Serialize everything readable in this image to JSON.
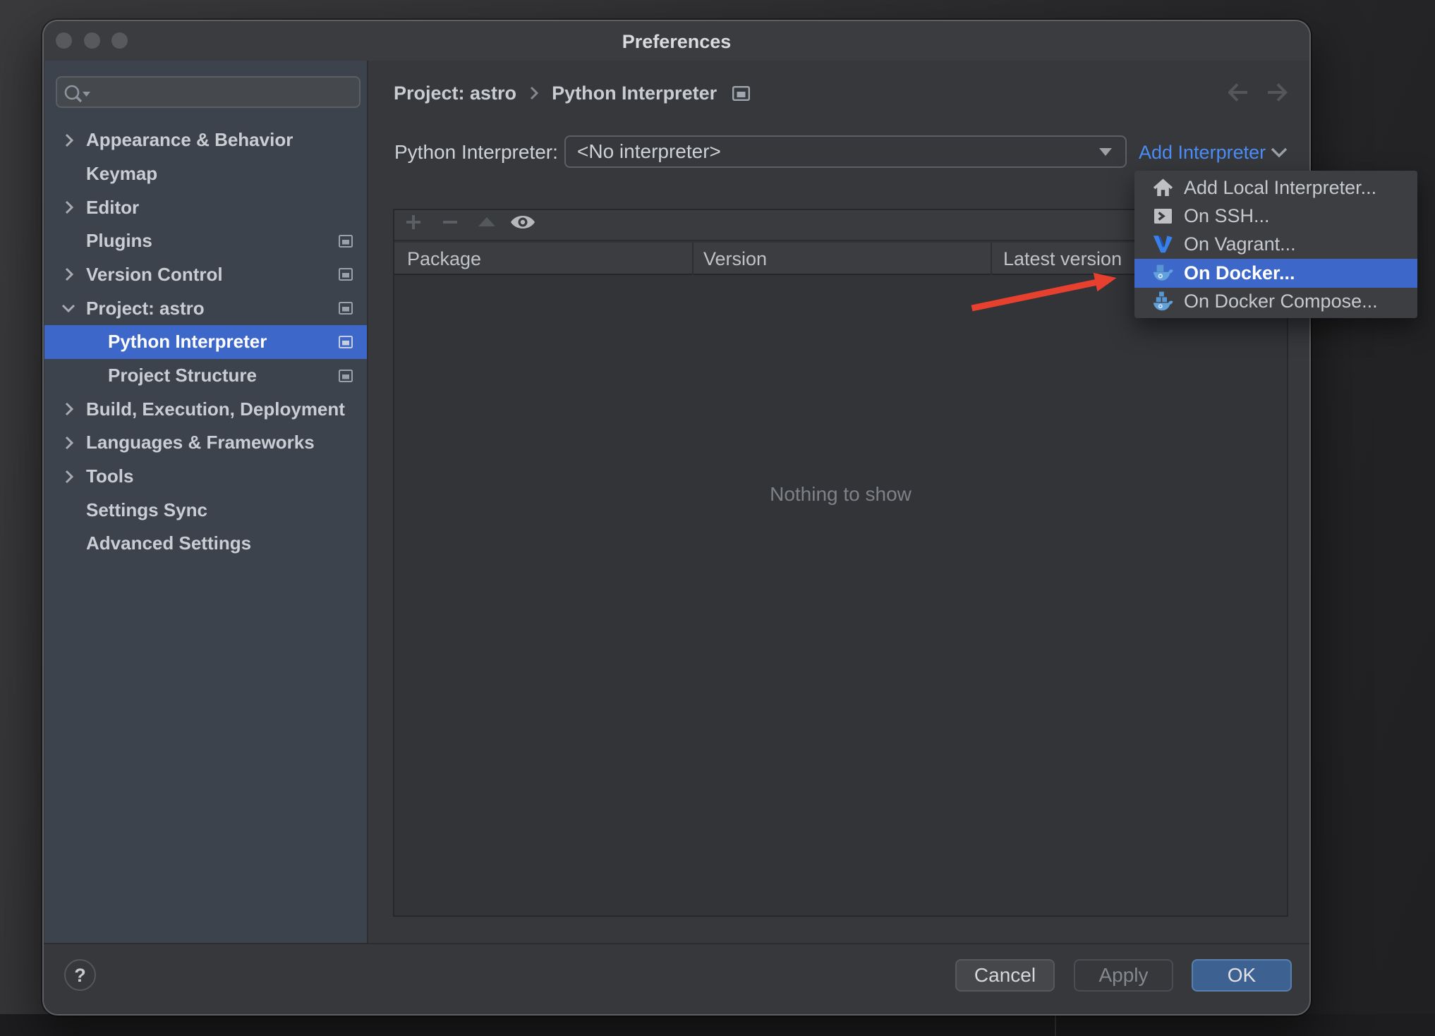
{
  "window": {
    "title": "Preferences"
  },
  "sidebar": {
    "search_placeholder": "",
    "items": [
      {
        "label": "Appearance & Behavior"
      },
      {
        "label": "Keymap"
      },
      {
        "label": "Editor"
      },
      {
        "label": "Plugins"
      },
      {
        "label": "Version Control"
      },
      {
        "label": "Project: astro"
      },
      {
        "label": "Python Interpreter"
      },
      {
        "label": "Project Structure"
      },
      {
        "label": "Build, Execution, Deployment"
      },
      {
        "label": "Languages & Frameworks"
      },
      {
        "label": "Tools"
      },
      {
        "label": "Settings Sync"
      },
      {
        "label": "Advanced Settings"
      }
    ]
  },
  "breadcrumb": {
    "first": "Project: astro",
    "second": "Python Interpreter"
  },
  "interpreter": {
    "label": "Python Interpreter:",
    "value": "<No interpreter>",
    "add_link": "Add Interpreter"
  },
  "menu": {
    "items": [
      {
        "label": "Add Local Interpreter..."
      },
      {
        "label": "On SSH..."
      },
      {
        "label": "On Vagrant..."
      },
      {
        "label": "On Docker..."
      },
      {
        "label": "On Docker Compose..."
      }
    ]
  },
  "table": {
    "columns": [
      "Package",
      "Version",
      "Latest version"
    ],
    "empty_text": "Nothing to show"
  },
  "footer": {
    "help": "?",
    "cancel": "Cancel",
    "apply": "Apply",
    "ok": "OK"
  },
  "colors": {
    "selection_blue": "#3d67c9",
    "link_blue": "#4b8df8",
    "ok_blue": "#3d6191",
    "arrow_red": "#e8402f",
    "sidebar_bg": "#3d434c",
    "window_bg": "#36383b"
  }
}
